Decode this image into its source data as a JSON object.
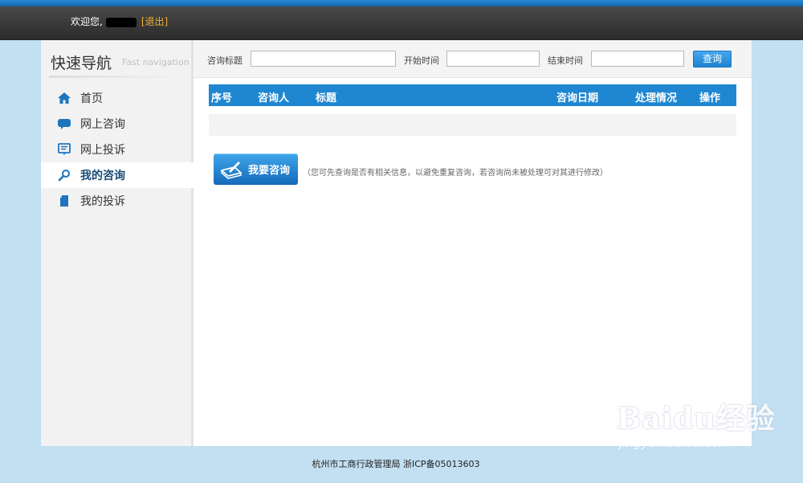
{
  "header": {
    "welcome": "欢迎您,",
    "logout": "[退出]"
  },
  "sidebar": {
    "title": "快速导航",
    "subtitle": "Fast navigation",
    "items": [
      {
        "label": "首页",
        "icon": "home-icon"
      },
      {
        "label": "网上咨询",
        "icon": "chat-bubble-icon"
      },
      {
        "label": "网上投诉",
        "icon": "complaint-icon"
      },
      {
        "label": "我的咨询",
        "icon": "search-icon",
        "active": true
      },
      {
        "label": "我的投诉",
        "icon": "document-icon"
      }
    ]
  },
  "search": {
    "title_label": "咨询标题",
    "start_label": "开始时间",
    "end_label": "结束时间",
    "button": "查询"
  },
  "table": {
    "headers": [
      "序号",
      "咨询人",
      "标题",
      "咨询日期",
      "处理情况",
      "操作"
    ]
  },
  "consult": {
    "button": "我要咨询",
    "hint": "（您可先查询是否有相关信息，以避免重复咨询，若咨询尚未被处理可对其进行修改）"
  },
  "footer": "杭州市工商行政管理局 浙ICP备05013603",
  "watermark": {
    "main": "Baidu经验",
    "sub": "jingyan.baidu.com"
  },
  "colors": {
    "accent": "#1f87d1",
    "background": "#c2e0f1",
    "logout": "#f0b030"
  }
}
